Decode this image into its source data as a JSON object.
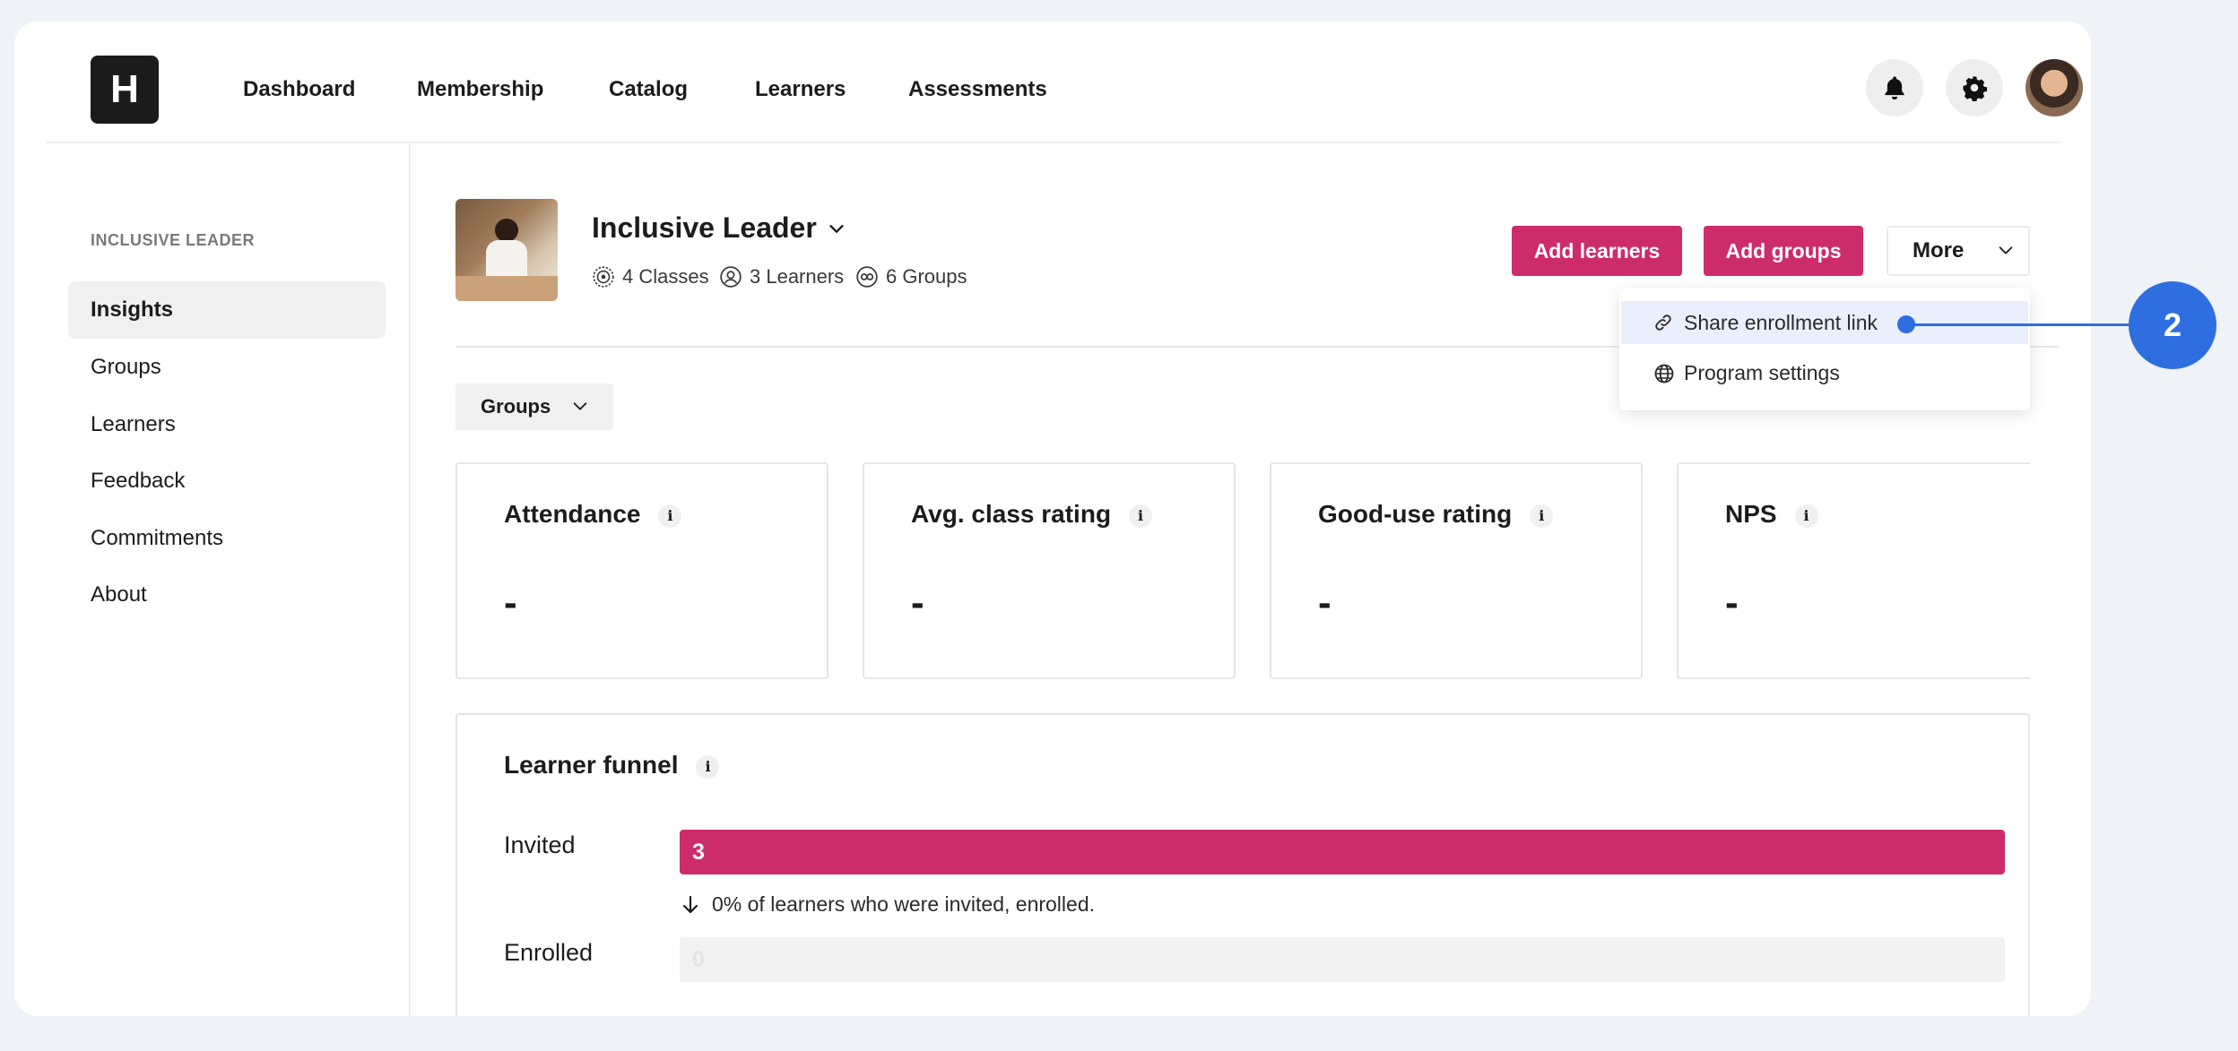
{
  "nav": {
    "logo_letter": "H",
    "items": [
      "Dashboard",
      "Membership",
      "Catalog",
      "Learners",
      "Assessments"
    ]
  },
  "icons": {
    "notifications": "bell-icon",
    "settings": "gear-icon",
    "profile": "avatar"
  },
  "sidebar": {
    "section_title": "INCLUSIVE LEADER",
    "items": [
      {
        "label": "Insights",
        "active": true
      },
      {
        "label": "Groups"
      },
      {
        "label": "Learners"
      },
      {
        "label": "Feedback"
      },
      {
        "label": "Commitments"
      },
      {
        "label": "About"
      }
    ]
  },
  "program": {
    "title": "Inclusive Leader",
    "classes": "4 Classes",
    "learners": "3 Learners",
    "groups": "6 Groups"
  },
  "actions": {
    "add_learners": "Add learners",
    "add_groups": "Add groups",
    "more": "More"
  },
  "more_menu": {
    "items": [
      {
        "label": "Share enrollment link",
        "icon": "link-icon",
        "highlighted": true
      },
      {
        "label": "Program settings",
        "icon": "globe-icon"
      }
    ]
  },
  "filter": {
    "label": "Groups"
  },
  "metrics": [
    {
      "label": "Attendance",
      "value": "-"
    },
    {
      "label": "Avg. class rating",
      "value": "-"
    },
    {
      "label": "Good-use rating",
      "value": "-"
    },
    {
      "label": "NPS",
      "value": "-"
    }
  ],
  "funnel": {
    "title": "Learner funnel",
    "invited": {
      "label": "Invited",
      "value": "3",
      "fill_fraction": 1.0
    },
    "conversion_text": "0% of learners who were invited, enrolled.",
    "enrolled": {
      "label": "Enrolled",
      "value": "0",
      "fill_fraction": 0.0
    }
  },
  "annotation": {
    "step": "2"
  },
  "colors": {
    "accent": "#cd2c6b",
    "annotation": "#2f6ee0",
    "highlight": "#e9effd"
  }
}
